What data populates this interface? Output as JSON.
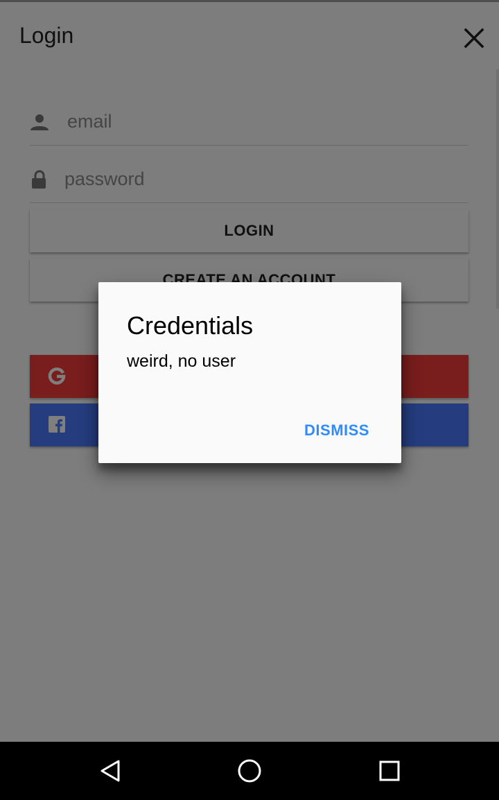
{
  "header": {
    "title": "Login",
    "close_icon": "close-icon"
  },
  "form": {
    "email_placeholder": "email",
    "password_placeholder": "password",
    "login_label": "LOGIN",
    "create_account_label": "CREATE AN ACCOUNT"
  },
  "social": {
    "google_icon": "google-icon",
    "facebook_icon": "facebook-icon",
    "google_color": "#f23a3a",
    "facebook_color": "#4a7aff"
  },
  "dialog": {
    "title": "Credentials",
    "message": "weird, no user",
    "dismiss_label": "DISMISS",
    "accent_color": "#2f8cff"
  },
  "navbar": {
    "back_icon": "back-icon",
    "home_icon": "home-icon",
    "recents_icon": "recents-icon"
  }
}
